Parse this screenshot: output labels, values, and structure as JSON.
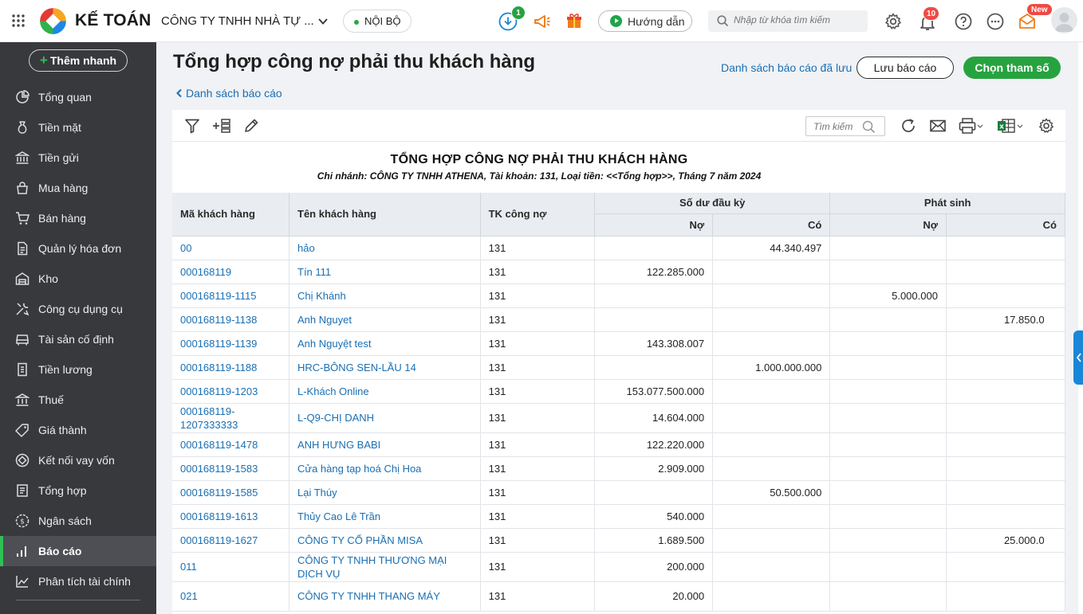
{
  "topbar": {
    "brand": "KẾ TOÁN",
    "company": "CÔNG TY TNHH NHÀ TỰ ...",
    "scope": "NỘI BỘ",
    "download_badge": "1",
    "guide_label": "Hướng dẫn",
    "search_placeholder": "Nhập từ khóa tìm kiếm",
    "notification_badge": "10",
    "new_badge": "New"
  },
  "sidebar": {
    "quick_add": "Thêm nhanh",
    "items": [
      {
        "label": "Tổng quan",
        "icon": "overview-icon"
      },
      {
        "label": "Tiền mặt",
        "icon": "cash-icon"
      },
      {
        "label": "Tiền gửi",
        "icon": "bank-deposit-icon"
      },
      {
        "label": "Mua hàng",
        "icon": "purchase-bag-icon"
      },
      {
        "label": "Bán hàng",
        "icon": "cart-icon"
      },
      {
        "label": "Quản lý hóa đơn",
        "icon": "invoice-icon"
      },
      {
        "label": "Kho",
        "icon": "warehouse-icon"
      },
      {
        "label": "Công cụ dụng cụ",
        "icon": "tools-icon"
      },
      {
        "label": "Tài sản cố định",
        "icon": "fixed-asset-icon"
      },
      {
        "label": "Tiền lương",
        "icon": "payroll-icon"
      },
      {
        "label": "Thuế",
        "icon": "tax-icon"
      },
      {
        "label": "Giá thành",
        "icon": "price-tag-icon"
      },
      {
        "label": "Kết nối vay vốn",
        "icon": "loan-icon"
      },
      {
        "label": "Tổng hợp",
        "icon": "summary-icon"
      },
      {
        "label": "Ngân sách",
        "icon": "budget-icon"
      },
      {
        "label": "Báo cáo",
        "icon": "report-chart-icon"
      },
      {
        "label": "Phân tích tài chính",
        "icon": "finance-analysis-icon"
      }
    ]
  },
  "page": {
    "title": "Tổng hợp công nợ phải thu khách hàng",
    "back_link": "Danh sách báo cáo",
    "saved_reports_link": "Danh sách báo cáo đã lưu",
    "save_button": "Lưu báo cáo",
    "params_button": "Chọn tham số",
    "toolbar_search_placeholder": "Tìm kiếm"
  },
  "report": {
    "title": "TỔNG HỢP CÔNG NỢ PHẢI THU KHÁCH HÀNG",
    "subtitle": "Chi nhánh: CÔNG TY TNHH ATHENA, Tài khoản: 131, Loại tiền: <<Tổng hợp>>, Tháng 7 năm 2024",
    "headers": {
      "code": "Mã khách hàng",
      "name": "Tên khách hàng",
      "account": "TK công nợ",
      "opening": "Số dư đầu kỳ",
      "arising": "Phát sinh",
      "debit": "Nợ",
      "credit": "Có"
    },
    "rows": [
      {
        "code": "00",
        "name": "hảo",
        "account": "131",
        "open_debit": "",
        "open_credit": "44.340.497",
        "ar_debit": "",
        "ar_credit": ""
      },
      {
        "code": "000168119",
        "name": "Tín 111",
        "account": "131",
        "open_debit": "122.285.000",
        "open_credit": "",
        "ar_debit": "",
        "ar_credit": ""
      },
      {
        "code": "000168119-1115",
        "name": "Chị Khánh",
        "account": "131",
        "open_debit": "",
        "open_credit": "",
        "ar_debit": "5.000.000",
        "ar_credit": ""
      },
      {
        "code": "000168119-1138",
        "name": "Anh Nguyet",
        "account": "131",
        "open_debit": "",
        "open_credit": "",
        "ar_debit": "",
        "ar_credit": "17.850.0"
      },
      {
        "code": "000168119-1139",
        "name": "Anh Nguyệt test",
        "account": "131",
        "open_debit": "143.308.007",
        "open_credit": "",
        "ar_debit": "",
        "ar_credit": ""
      },
      {
        "code": "000168119-1188",
        "name": "HRC-BÔNG SEN-LẦU 14",
        "account": "131",
        "open_debit": "",
        "open_credit": "1.000.000.000",
        "ar_debit": "",
        "ar_credit": ""
      },
      {
        "code": "000168119-1203",
        "name": "L-Khách Online",
        "account": "131",
        "open_debit": "153.077.500.000",
        "open_credit": "",
        "ar_debit": "",
        "ar_credit": ""
      },
      {
        "code": "000168119-1207333333",
        "name": "L-Q9-CHỊ DANH",
        "account": "131",
        "open_debit": "14.604.000",
        "open_credit": "",
        "ar_debit": "",
        "ar_credit": ""
      },
      {
        "code": "000168119-1478",
        "name": "ANH HƯNG BABI",
        "account": "131",
        "open_debit": "122.220.000",
        "open_credit": "",
        "ar_debit": "",
        "ar_credit": ""
      },
      {
        "code": "000168119-1583",
        "name": "Cửa hàng tạp hoá Chị Hoa",
        "account": "131",
        "open_debit": "2.909.000",
        "open_credit": "",
        "ar_debit": "",
        "ar_credit": ""
      },
      {
        "code": "000168119-1585",
        "name": "Lại Thúy",
        "account": "131",
        "open_debit": "",
        "open_credit": "50.500.000",
        "ar_debit": "",
        "ar_credit": ""
      },
      {
        "code": "000168119-1613",
        "name": "Thủy Cao Lê Trần",
        "account": "131",
        "open_debit": "540.000",
        "open_credit": "",
        "ar_debit": "",
        "ar_credit": ""
      },
      {
        "code": "000168119-1627",
        "name": "CÔNG TY CỔ PHẦN MISA",
        "account": "131",
        "open_debit": "1.689.500",
        "open_credit": "",
        "ar_debit": "",
        "ar_credit": "25.000.0"
      },
      {
        "code": "011",
        "name": "CÔNG TY TNHH THƯƠNG MẠI DỊCH VỤ",
        "account": "131",
        "open_debit": "200.000",
        "open_credit": "",
        "ar_debit": "",
        "ar_credit": ""
      },
      {
        "code": "021",
        "name": "CÔNG TY TNHH THANG MÁY",
        "account": "131",
        "open_debit": "20.000",
        "open_credit": "",
        "ar_debit": "",
        "ar_credit": ""
      }
    ]
  },
  "colors": {
    "accent_green": "#26a33e",
    "link_blue": "#1a6fb3",
    "sidebar_bg": "#38393d",
    "header_bg": "#e9ecf0"
  }
}
